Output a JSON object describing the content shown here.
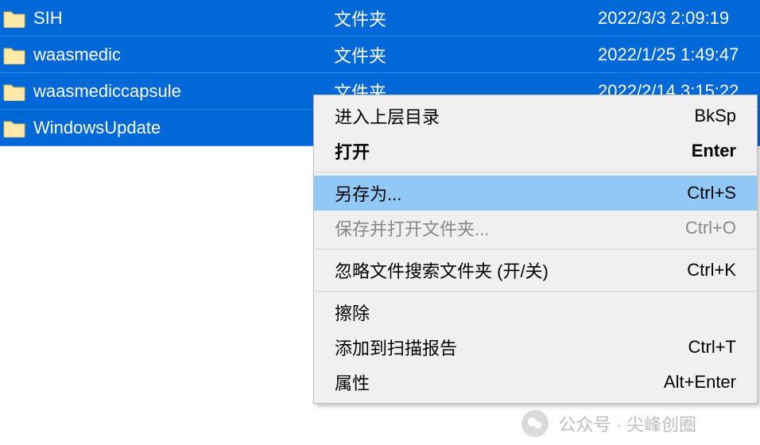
{
  "colors": {
    "row_bg": "#0168d7",
    "row_text": "#ffffff",
    "menu_bg": "#f0f0f0",
    "menu_hover": "#90c8f6",
    "menu_disabled": "#888888"
  },
  "files": [
    {
      "name": "SIH",
      "type": "文件夹",
      "date": "2022/3/3 2:09:19"
    },
    {
      "name": "waasmedic",
      "type": "文件夹",
      "date": "2022/1/25 1:49:47"
    },
    {
      "name": "waasmediccapsule",
      "type": "文件夹",
      "date": "2022/2/14 3:15:22"
    },
    {
      "name": "WindowsUpdate",
      "type": "",
      "date": ""
    }
  ],
  "menu": {
    "items": [
      {
        "label": "进入上层目录",
        "shortcut": "BkSp",
        "kind": "item"
      },
      {
        "label": "打开",
        "shortcut": "Enter",
        "kind": "item",
        "bold": true
      },
      {
        "kind": "sep"
      },
      {
        "label": "另存为...",
        "shortcut": "Ctrl+S",
        "kind": "item",
        "hover": true
      },
      {
        "label": "保存并打开文件夹...",
        "shortcut": "Ctrl+O",
        "kind": "item",
        "disabled": true
      },
      {
        "kind": "sep"
      },
      {
        "label": "忽略文件搜索文件夹  (开/关)",
        "shortcut": "Ctrl+K",
        "kind": "item"
      },
      {
        "kind": "sep"
      },
      {
        "label": "擦除",
        "shortcut": "",
        "kind": "item"
      },
      {
        "label": "添加到扫描报告",
        "shortcut": "Ctrl+T",
        "kind": "item"
      },
      {
        "label": "属性",
        "shortcut": "Alt+Enter",
        "kind": "item"
      }
    ]
  },
  "watermark": {
    "text": "公众号 · 尖峰创圈"
  }
}
